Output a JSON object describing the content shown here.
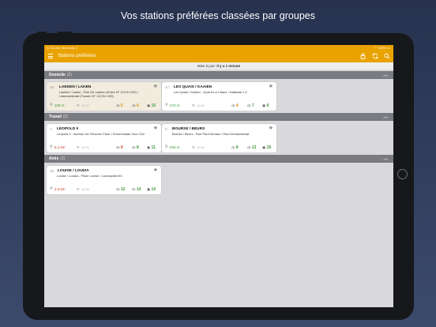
{
  "caption": "Vos stations préférées classées par groupes",
  "statusbar": {
    "time": "17:31 AM",
    "date": "Mon May 2",
    "battery": "100%"
  },
  "navbar": {
    "title": "Stations préférées"
  },
  "update": {
    "label": "Mise à jour:",
    "value": "Il y a 1 minute"
  },
  "groups": [
    {
      "name": "Domicile",
      "count": "(2)",
      "cards": [
        {
          "num": "30.",
          "name": "LAEKEN / LAKEN",
          "addr": "Laeken / Laken - Rue De Laeken (Entre N° 119 Et 109) / Lakensestraat (Tussen N° 119 En 109)",
          "dist": "328 m",
          "time": "11:27",
          "bikes": "5",
          "ebikes": "4",
          "stands": "15",
          "selected": true
        },
        {
          "num": "47.",
          "name": "LES QUAIS / KAAIEN",
          "addr": "Les Quais / Kaaien - Quai A La Chaux / Kalkkaai 1-2",
          "dist": "274 m",
          "time": "11:24",
          "bikes": "4",
          "ebikes": "7",
          "stands": "9",
          "selected": false
        }
      ]
    },
    {
      "name": "Travail",
      "count": "(2)",
      "cards": [
        {
          "num": "1.",
          "name": "LEOPOLD II",
          "addr": "Leopold II - Avenue De Tervuren Face / Tervurenlaan Voor 218",
          "dist": "5.1 km",
          "time": "11:25",
          "bikes": "0",
          "ebikes": "8",
          "stands": "11",
          "selected": false
        },
        {
          "num": "8.",
          "name": "BOURSE / BEURS",
          "addr": "Bourse / Beurs - Rue Paul Devaux / Paul Devauxstraat",
          "dist": "836 m",
          "time": "11:26",
          "bikes": "8",
          "ebikes": "13",
          "stands": "18",
          "selected": false
        }
      ]
    },
    {
      "name": "Amis",
      "count": "(1)",
      "cards": [
        {
          "num": "16.",
          "name": "LOUISE / LOUIZA",
          "addr": "Louise / Louiza - Place Louise / Louizaplein 53",
          "dist": "2.3 km",
          "time": "11:26",
          "bikes": "12",
          "ebikes": "14",
          "stands": "14",
          "selected": false
        }
      ]
    }
  ],
  "colors": {
    "accent": "#e9a200",
    "green": "#3d9a3d",
    "orange": "#e38a00",
    "red": "#c9331e"
  },
  "icons": {
    "menu": "hamburger-icon",
    "bike": "bicycle-icon",
    "stand": "parking-icon",
    "star": "star-icon",
    "pin": "location-pin-icon",
    "refresh": "refresh-icon",
    "search": "search-icon",
    "sync": "sync-icon",
    "locked": "lock-icon"
  }
}
